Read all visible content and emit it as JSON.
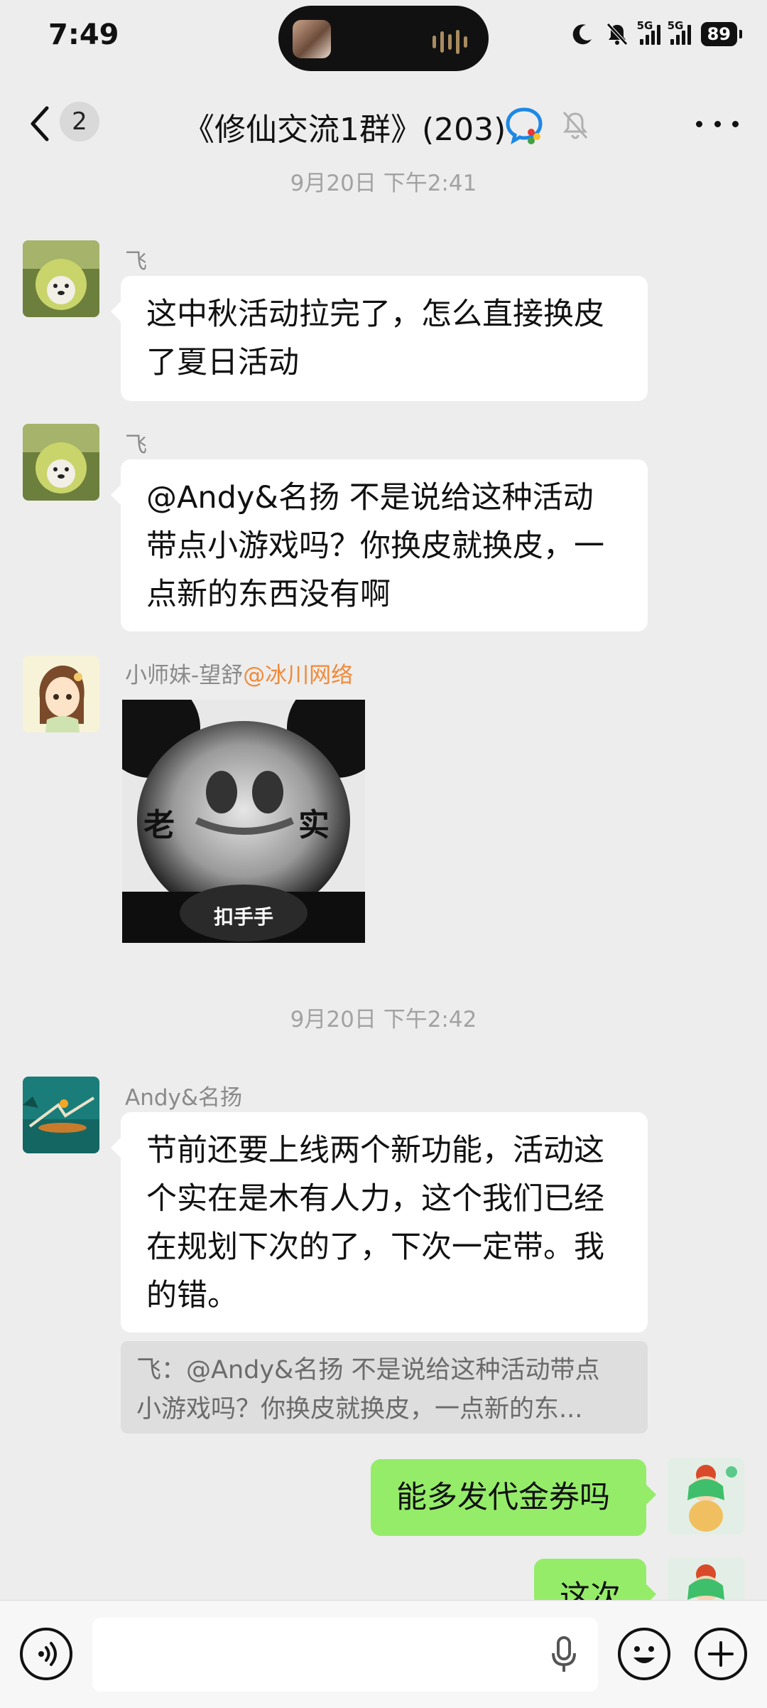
{
  "status": {
    "time": "7:49",
    "network1": "5G",
    "network2": "5G",
    "battery": "89"
  },
  "nav": {
    "badge_count": "2",
    "title": "《修仙交流1群》(203)"
  },
  "timestamps": [
    "9月20日 下午2:41",
    "9月20日 下午2:42"
  ],
  "messages": [
    {
      "sender": "飞",
      "lines": [
        "这中秋活动拉完了，怎么直接换皮",
        "了夏日活动"
      ]
    },
    {
      "sender": "飞",
      "lines": [
        "@Andy&名扬  不是说给这种活动",
        "带点小游戏吗？你换皮就换皮，一",
        "点新的东西没有啊"
      ]
    },
    {
      "sender": "小师妹-望舒",
      "sender_org": "@冰川网络",
      "sticker": {
        "text_left": "老",
        "text_right": "实",
        "caption": "扣手手"
      }
    },
    {
      "sender": "Andy&名扬",
      "lines": [
        "节前还要上线两个新功能，活动这",
        "个实在是木有人力，这个我们已经",
        "在规划下次的了，下次一定带。我",
        "的错。"
      ],
      "quote_lines": [
        "飞：@Andy&名扬 不是说给这种活动带点",
        "小游戏吗？你换皮就换皮，一点新的东..."
      ]
    },
    {
      "sender": "me",
      "text": "能多发代金券吗"
    },
    {
      "sender": "me",
      "text": "这次"
    }
  ],
  "icons": [
    "back-chevron-icon",
    "enterprise-chat-icon",
    "mute-bell-icon",
    "more-icon",
    "voice-icon",
    "microphone-icon",
    "emoji-icon",
    "plus-icon"
  ],
  "colors": {
    "background": "#ededed",
    "self_bubble": "#95ec69",
    "org_tag": "#f08a3a"
  }
}
